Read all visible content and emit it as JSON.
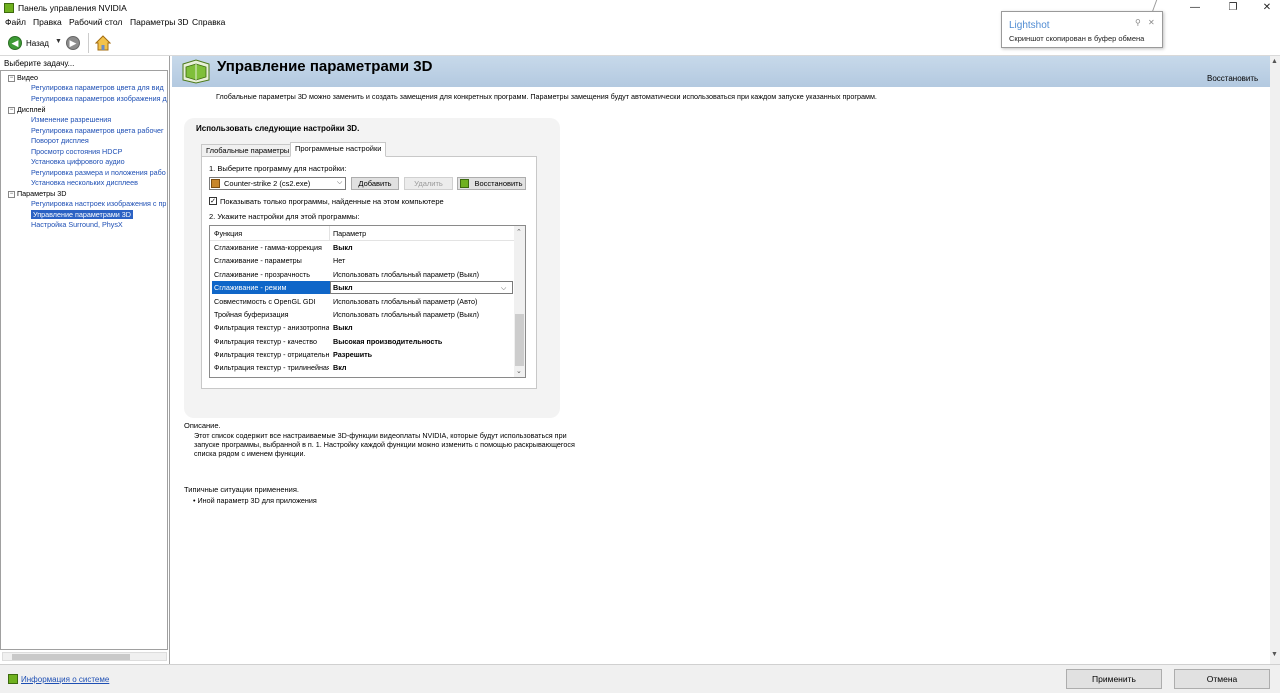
{
  "window": {
    "title": "Панель управления NVIDIA",
    "minimize": "—",
    "maximize": "❐",
    "close": "✕"
  },
  "menu": [
    "Файл",
    "Правка",
    "Рабочий стол",
    "Параметры 3D",
    "Справка"
  ],
  "toolbar": {
    "back_label": "Назад",
    "back_icon": "arrow-left-icon",
    "forward_icon": "arrow-right-icon",
    "home_icon": "home-icon"
  },
  "sidebar": {
    "header": "Выберите задачу...",
    "tree": [
      {
        "type": "category",
        "label": "Видео",
        "expander": "⊟"
      },
      {
        "type": "link",
        "label": "Регулировка параметров цвета для вид"
      },
      {
        "type": "link",
        "label": "Регулировка параметров изображения д"
      },
      {
        "type": "category",
        "label": "Дисплей",
        "expander": "⊟"
      },
      {
        "type": "link",
        "label": "Изменение разрешения"
      },
      {
        "type": "link",
        "label": "Регулировка параметров цвета рабочег"
      },
      {
        "type": "link",
        "label": "Поворот дисплея"
      },
      {
        "type": "link",
        "label": "Просмотр состояния HDCP"
      },
      {
        "type": "link",
        "label": "Установка цифрового аудио"
      },
      {
        "type": "link",
        "label": "Регулировка размера и положения рабо"
      },
      {
        "type": "link",
        "label": "Установка нескольких дисплеев"
      },
      {
        "type": "category",
        "label": "Параметры 3D",
        "expander": "⊟"
      },
      {
        "type": "link",
        "label": "Регулировка настроек изображения с пр"
      },
      {
        "type": "selected",
        "label": "Управление параметрами 3D"
      },
      {
        "type": "link",
        "label": "Настройка Surround, PhysX"
      }
    ]
  },
  "status": {
    "sysinfo": "Информация о системе",
    "apply": "Применить",
    "cancel": "Отмена"
  },
  "page": {
    "title": "Управление параметрами 3D",
    "restore": "Восстановить",
    "description": "Глобальные параметры 3D можно заменить и создать замещения для конкретных программ. Параметры замещения будут автоматически использоваться при каждом запуске указанных программ.",
    "settings_title": "Использовать следующие настройки 3D.",
    "tabs": [
      "Глобальные параметры",
      "Программные настройки"
    ],
    "step1": "1. Выберите программу для настройки:",
    "program": "Counter-strike 2 (cs2.exe)",
    "btn_add": "Добавить",
    "btn_delete": "Удалить",
    "btn_restore": "Восстановить",
    "show_only": "Показывать только программы, найденные на этом компьютере",
    "show_only_checked": "✓",
    "step2": "2. Укажите настройки для этой программы:",
    "grid_headers": [
      "Функция",
      "Параметр"
    ],
    "grid_rows": [
      {
        "f": "Сглаживание - гамма-коррекция",
        "p": "Выкл",
        "bold": true
      },
      {
        "f": "Сглаживание - параметры",
        "p": "Нет",
        "bold": false
      },
      {
        "f": "Сглаживание - прозрачность",
        "p": "Использовать глобальный параметр (Выкл)",
        "bold": false
      },
      {
        "f": "Сглаживание - режим",
        "p": "Выкл",
        "bold": true,
        "selected": true
      },
      {
        "f": "Совместимость с OpenGL GDI",
        "p": "Использовать глобальный параметр (Авто)",
        "bold": false
      },
      {
        "f": "Тройная буферизация",
        "p": "Использовать глобальный параметр (Выкл)",
        "bold": false
      },
      {
        "f": "Фильтрация текстур - анизотропная",
        "p": "Выкл",
        "bold": true
      },
      {
        "f": "Фильтрация текстур - качество",
        "p": "Высокая производительность",
        "bold": true
      },
      {
        "f": "Фильтрация текстур - отрицательное отклонение УД",
        "p": "Разрешить",
        "bold": true
      },
      {
        "f": "Фильтрация текстур - трилинейная оптимизация",
        "p": "Вкл",
        "bold": true
      }
    ],
    "desc_label": "Описание.",
    "desc_text": "Этот список содержит все настраиваемые 3D-функции видеоплаты NVIDIA, которые будут использоваться при запуске программы, выбранной в п. 1. Настройку каждой функции можно изменить с помощью раскрывающегося списка рядом с именем функции.",
    "typical_label": "Типичные ситуации применения.",
    "typical_item": "• Иной параметр 3D для приложения"
  },
  "lightshot": {
    "title": "Lightshot",
    "text": "Скриншот скопирован в буфер обмена",
    "pin": "⚲",
    "close": "✕"
  },
  "colors": {
    "header_bg": "#c7d9ea",
    "link": "#1e4fb4",
    "selection": "#0f66c8",
    "nvidia_green": "#6fb11f"
  }
}
